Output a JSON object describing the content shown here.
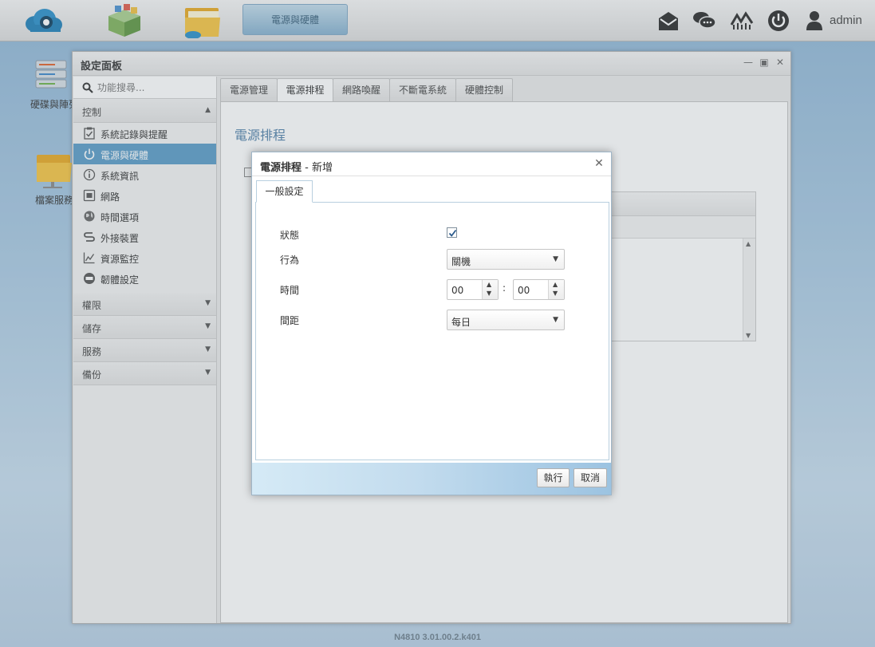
{
  "taskbar": {
    "active_app_label": "電源與硬體",
    "user_label": "admin"
  },
  "desktop": {
    "icon1_label": "硬碟與陣列",
    "icon2_label": "檔案服務"
  },
  "window": {
    "title": "設定面板"
  },
  "sidebar": {
    "search_placeholder": "功能搜尋...",
    "section_control": "控制",
    "items": [
      {
        "label": "系統記錄與提醒",
        "icon": "checklist-icon"
      },
      {
        "label": "電源與硬體",
        "icon": "power-icon"
      },
      {
        "label": "系統資訊",
        "icon": "info-icon"
      },
      {
        "label": "網路",
        "icon": "network-icon"
      },
      {
        "label": "時間選項",
        "icon": "globe-icon"
      },
      {
        "label": "外接裝置",
        "icon": "usb-icon"
      },
      {
        "label": "資源監控",
        "icon": "chart-icon"
      },
      {
        "label": "韌體設定",
        "icon": "firmware-icon"
      }
    ],
    "section_permissions": "權限",
    "section_storage": "儲存",
    "section_services": "服務",
    "section_backup": "備份"
  },
  "tabs": [
    "電源管理",
    "電源排程",
    "網路喚醒",
    "不斷電系統",
    "硬體控制"
  ],
  "content": {
    "page_title": "電源排程"
  },
  "dialog": {
    "title_main": "電源排程",
    "title_sub": " - 新增",
    "tab_label": "一般設定",
    "status_label": "狀態",
    "status_checked": true,
    "action_label": "行為",
    "action_value": "關機",
    "time_label": "時間",
    "hour_value": "00",
    "minute_value": "00",
    "time_separator": ":",
    "interval_label": "間距",
    "interval_value": "每日",
    "apply_button": "執行",
    "cancel_button": "取消"
  },
  "footer": {
    "version": "N4810   3.01.00.2.k401"
  },
  "colors": {
    "accent": "#5a9bc7",
    "page_title": "#4f7fa8"
  }
}
